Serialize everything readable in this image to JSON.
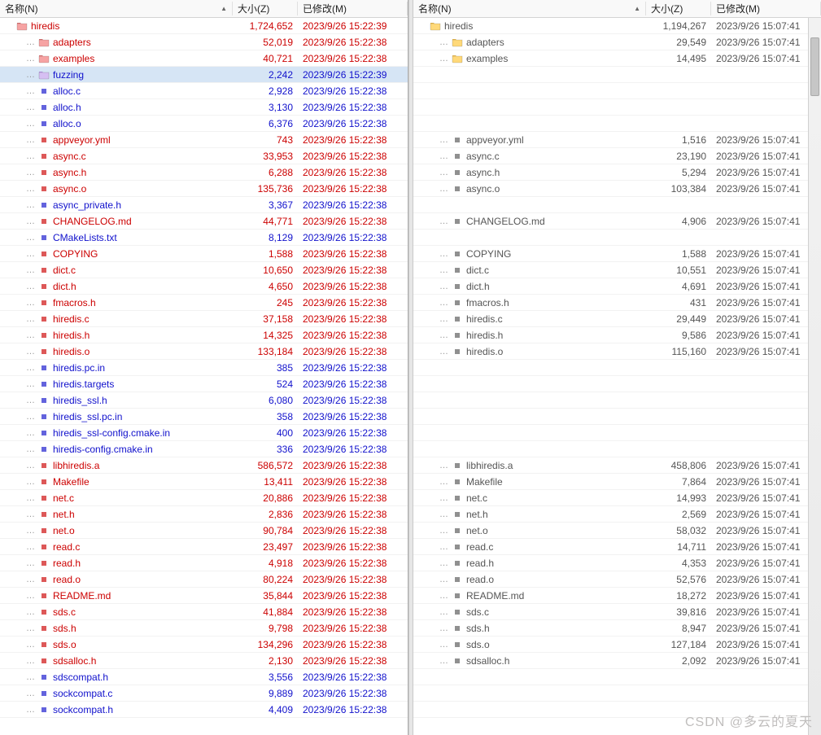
{
  "columns": {
    "name": "名称(N)",
    "size": "大小(Z)",
    "date": "已修改(M)"
  },
  "watermark": "CSDN @多云的夏天",
  "left": {
    "sorted_asc": true,
    "rows": [
      {
        "type": "folder",
        "color": "red",
        "indent": 0,
        "name": "hiredis",
        "size": "1,724,652",
        "date": "2023/9/26 15:22:39",
        "folderColor": "folder-red"
      },
      {
        "type": "folder",
        "color": "red",
        "indent": 1,
        "name": "adapters",
        "size": "52,019",
        "date": "2023/9/26 15:22:38",
        "folderColor": "folder-red"
      },
      {
        "type": "folder",
        "color": "red",
        "indent": 1,
        "name": "examples",
        "size": "40,721",
        "date": "2023/9/26 15:22:38",
        "folderColor": "folder-red"
      },
      {
        "type": "folder",
        "color": "blue",
        "indent": 1,
        "name": "fuzzing",
        "size": "2,242",
        "date": "2023/9/26 15:22:39",
        "selected": true,
        "folderColor": "folder-purple"
      },
      {
        "type": "file",
        "color": "blue",
        "indent": 1,
        "name": "alloc.c",
        "size": "2,928",
        "date": "2023/9/26 15:22:38"
      },
      {
        "type": "file",
        "color": "blue",
        "indent": 1,
        "name": "alloc.h",
        "size": "3,130",
        "date": "2023/9/26 15:22:38"
      },
      {
        "type": "file",
        "color": "blue",
        "indent": 1,
        "name": "alloc.o",
        "size": "6,376",
        "date": "2023/9/26 15:22:38"
      },
      {
        "type": "file",
        "color": "red",
        "indent": 1,
        "name": "appveyor.yml",
        "size": "743",
        "date": "2023/9/26 15:22:38"
      },
      {
        "type": "file",
        "color": "red",
        "indent": 1,
        "name": "async.c",
        "size": "33,953",
        "date": "2023/9/26 15:22:38"
      },
      {
        "type": "file",
        "color": "red",
        "indent": 1,
        "name": "async.h",
        "size": "6,288",
        "date": "2023/9/26 15:22:38"
      },
      {
        "type": "file",
        "color": "red",
        "indent": 1,
        "name": "async.o",
        "size": "135,736",
        "date": "2023/9/26 15:22:38"
      },
      {
        "type": "file",
        "color": "blue",
        "indent": 1,
        "name": "async_private.h",
        "size": "3,367",
        "date": "2023/9/26 15:22:38"
      },
      {
        "type": "file",
        "color": "red",
        "indent": 1,
        "name": "CHANGELOG.md",
        "size": "44,771",
        "date": "2023/9/26 15:22:38"
      },
      {
        "type": "file",
        "color": "blue",
        "indent": 1,
        "name": "CMakeLists.txt",
        "size": "8,129",
        "date": "2023/9/26 15:22:38"
      },
      {
        "type": "file",
        "color": "red",
        "indent": 1,
        "name": "COPYING",
        "size": "1,588",
        "date": "2023/9/26 15:22:38"
      },
      {
        "type": "file",
        "color": "red",
        "indent": 1,
        "name": "dict.c",
        "size": "10,650",
        "date": "2023/9/26 15:22:38"
      },
      {
        "type": "file",
        "color": "red",
        "indent": 1,
        "name": "dict.h",
        "size": "4,650",
        "date": "2023/9/26 15:22:38"
      },
      {
        "type": "file",
        "color": "red",
        "indent": 1,
        "name": "fmacros.h",
        "size": "245",
        "date": "2023/9/26 15:22:38"
      },
      {
        "type": "file",
        "color": "red",
        "indent": 1,
        "name": "hiredis.c",
        "size": "37,158",
        "date": "2023/9/26 15:22:38"
      },
      {
        "type": "file",
        "color": "red",
        "indent": 1,
        "name": "hiredis.h",
        "size": "14,325",
        "date": "2023/9/26 15:22:38"
      },
      {
        "type": "file",
        "color": "red",
        "indent": 1,
        "name": "hiredis.o",
        "size": "133,184",
        "date": "2023/9/26 15:22:38"
      },
      {
        "type": "file",
        "color": "blue",
        "indent": 1,
        "name": "hiredis.pc.in",
        "size": "385",
        "date": "2023/9/26 15:22:38"
      },
      {
        "type": "file",
        "color": "blue",
        "indent": 1,
        "name": "hiredis.targets",
        "size": "524",
        "date": "2023/9/26 15:22:38"
      },
      {
        "type": "file",
        "color": "blue",
        "indent": 1,
        "name": "hiredis_ssl.h",
        "size": "6,080",
        "date": "2023/9/26 15:22:38"
      },
      {
        "type": "file",
        "color": "blue",
        "indent": 1,
        "name": "hiredis_ssl.pc.in",
        "size": "358",
        "date": "2023/9/26 15:22:38"
      },
      {
        "type": "file",
        "color": "blue",
        "indent": 1,
        "name": "hiredis_ssl-config.cmake.in",
        "size": "400",
        "date": "2023/9/26 15:22:38"
      },
      {
        "type": "file",
        "color": "blue",
        "indent": 1,
        "name": "hiredis-config.cmake.in",
        "size": "336",
        "date": "2023/9/26 15:22:38"
      },
      {
        "type": "file",
        "color": "red",
        "indent": 1,
        "name": "libhiredis.a",
        "size": "586,572",
        "date": "2023/9/26 15:22:38"
      },
      {
        "type": "file",
        "color": "red",
        "indent": 1,
        "name": "Makefile",
        "size": "13,411",
        "date": "2023/9/26 15:22:38"
      },
      {
        "type": "file",
        "color": "red",
        "indent": 1,
        "name": "net.c",
        "size": "20,886",
        "date": "2023/9/26 15:22:38"
      },
      {
        "type": "file",
        "color": "red",
        "indent": 1,
        "name": "net.h",
        "size": "2,836",
        "date": "2023/9/26 15:22:38"
      },
      {
        "type": "file",
        "color": "red",
        "indent": 1,
        "name": "net.o",
        "size": "90,784",
        "date": "2023/9/26 15:22:38"
      },
      {
        "type": "file",
        "color": "red",
        "indent": 1,
        "name": "read.c",
        "size": "23,497",
        "date": "2023/9/26 15:22:38"
      },
      {
        "type": "file",
        "color": "red",
        "indent": 1,
        "name": "read.h",
        "size": "4,918",
        "date": "2023/9/26 15:22:38"
      },
      {
        "type": "file",
        "color": "red",
        "indent": 1,
        "name": "read.o",
        "size": "80,224",
        "date": "2023/9/26 15:22:38"
      },
      {
        "type": "file",
        "color": "red",
        "indent": 1,
        "name": "README.md",
        "size": "35,844",
        "date": "2023/9/26 15:22:38"
      },
      {
        "type": "file",
        "color": "red",
        "indent": 1,
        "name": "sds.c",
        "size": "41,884",
        "date": "2023/9/26 15:22:38"
      },
      {
        "type": "file",
        "color": "red",
        "indent": 1,
        "name": "sds.h",
        "size": "9,798",
        "date": "2023/9/26 15:22:38"
      },
      {
        "type": "file",
        "color": "red",
        "indent": 1,
        "name": "sds.o",
        "size": "134,296",
        "date": "2023/9/26 15:22:38"
      },
      {
        "type": "file",
        "color": "red",
        "indent": 1,
        "name": "sdsalloc.h",
        "size": "2,130",
        "date": "2023/9/26 15:22:38"
      },
      {
        "type": "file",
        "color": "blue",
        "indent": 1,
        "name": "sdscompat.h",
        "size": "3,556",
        "date": "2023/9/26 15:22:38"
      },
      {
        "type": "file",
        "color": "blue",
        "indent": 1,
        "name": "sockcompat.c",
        "size": "9,889",
        "date": "2023/9/26 15:22:38"
      },
      {
        "type": "file",
        "color": "blue",
        "indent": 1,
        "name": "sockcompat.h",
        "size": "4,409",
        "date": "2023/9/26 15:22:38"
      }
    ]
  },
  "right": {
    "sorted_asc": true,
    "rows": [
      {
        "type": "folder",
        "color": "gray",
        "indent": 0,
        "name": "hiredis",
        "size": "1,194,267",
        "date": "2023/9/26 15:07:41",
        "folderColor": "folder-yellow"
      },
      {
        "type": "folder",
        "color": "gray",
        "indent": 1,
        "name": "adapters",
        "size": "29,549",
        "date": "2023/9/26 15:07:41",
        "folderColor": "folder-yellow"
      },
      {
        "type": "folder",
        "color": "gray",
        "indent": 1,
        "name": "examples",
        "size": "14,495",
        "date": "2023/9/26 15:07:41",
        "folderColor": "folder-yellow"
      },
      {
        "type": "blank"
      },
      {
        "type": "blank"
      },
      {
        "type": "blank"
      },
      {
        "type": "blank"
      },
      {
        "type": "file",
        "color": "gray",
        "indent": 1,
        "name": "appveyor.yml",
        "size": "1,516",
        "date": "2023/9/26 15:07:41"
      },
      {
        "type": "file",
        "color": "gray",
        "indent": 1,
        "name": "async.c",
        "size": "23,190",
        "date": "2023/9/26 15:07:41"
      },
      {
        "type": "file",
        "color": "gray",
        "indent": 1,
        "name": "async.h",
        "size": "5,294",
        "date": "2023/9/26 15:07:41"
      },
      {
        "type": "file",
        "color": "gray",
        "indent": 1,
        "name": "async.o",
        "size": "103,384",
        "date": "2023/9/26 15:07:41"
      },
      {
        "type": "blank"
      },
      {
        "type": "file",
        "color": "gray",
        "indent": 1,
        "name": "CHANGELOG.md",
        "size": "4,906",
        "date": "2023/9/26 15:07:41"
      },
      {
        "type": "blank"
      },
      {
        "type": "file",
        "color": "gray",
        "indent": 1,
        "name": "COPYING",
        "size": "1,588",
        "date": "2023/9/26 15:07:41"
      },
      {
        "type": "file",
        "color": "gray",
        "indent": 1,
        "name": "dict.c",
        "size": "10,551",
        "date": "2023/9/26 15:07:41"
      },
      {
        "type": "file",
        "color": "gray",
        "indent": 1,
        "name": "dict.h",
        "size": "4,691",
        "date": "2023/9/26 15:07:41"
      },
      {
        "type": "file",
        "color": "gray",
        "indent": 1,
        "name": "fmacros.h",
        "size": "431",
        "date": "2023/9/26 15:07:41"
      },
      {
        "type": "file",
        "color": "gray",
        "indent": 1,
        "name": "hiredis.c",
        "size": "29,449",
        "date": "2023/9/26 15:07:41"
      },
      {
        "type": "file",
        "color": "gray",
        "indent": 1,
        "name": "hiredis.h",
        "size": "9,586",
        "date": "2023/9/26 15:07:41"
      },
      {
        "type": "file",
        "color": "gray",
        "indent": 1,
        "name": "hiredis.o",
        "size": "115,160",
        "date": "2023/9/26 15:07:41"
      },
      {
        "type": "blank"
      },
      {
        "type": "blank"
      },
      {
        "type": "blank"
      },
      {
        "type": "blank"
      },
      {
        "type": "blank"
      },
      {
        "type": "blank"
      },
      {
        "type": "file",
        "color": "gray",
        "indent": 1,
        "name": "libhiredis.a",
        "size": "458,806",
        "date": "2023/9/26 15:07:41"
      },
      {
        "type": "file",
        "color": "gray",
        "indent": 1,
        "name": "Makefile",
        "size": "7,864",
        "date": "2023/9/26 15:07:41"
      },
      {
        "type": "file",
        "color": "gray",
        "indent": 1,
        "name": "net.c",
        "size": "14,993",
        "date": "2023/9/26 15:07:41"
      },
      {
        "type": "file",
        "color": "gray",
        "indent": 1,
        "name": "net.h",
        "size": "2,569",
        "date": "2023/9/26 15:07:41"
      },
      {
        "type": "file",
        "color": "gray",
        "indent": 1,
        "name": "net.o",
        "size": "58,032",
        "date": "2023/9/26 15:07:41"
      },
      {
        "type": "file",
        "color": "gray",
        "indent": 1,
        "name": "read.c",
        "size": "14,711",
        "date": "2023/9/26 15:07:41"
      },
      {
        "type": "file",
        "color": "gray",
        "indent": 1,
        "name": "read.h",
        "size": "4,353",
        "date": "2023/9/26 15:07:41"
      },
      {
        "type": "file",
        "color": "gray",
        "indent": 1,
        "name": "read.o",
        "size": "52,576",
        "date": "2023/9/26 15:07:41"
      },
      {
        "type": "file",
        "color": "gray",
        "indent": 1,
        "name": "README.md",
        "size": "18,272",
        "date": "2023/9/26 15:07:41"
      },
      {
        "type": "file",
        "color": "gray",
        "indent": 1,
        "name": "sds.c",
        "size": "39,816",
        "date": "2023/9/26 15:07:41"
      },
      {
        "type": "file",
        "color": "gray",
        "indent": 1,
        "name": "sds.h",
        "size": "8,947",
        "date": "2023/9/26 15:07:41"
      },
      {
        "type": "file",
        "color": "gray",
        "indent": 1,
        "name": "sds.o",
        "size": "127,184",
        "date": "2023/9/26 15:07:41"
      },
      {
        "type": "file",
        "color": "gray",
        "indent": 1,
        "name": "sdsalloc.h",
        "size": "2,092",
        "date": "2023/9/26 15:07:41"
      },
      {
        "type": "blank"
      },
      {
        "type": "blank"
      },
      {
        "type": "blank"
      }
    ]
  }
}
